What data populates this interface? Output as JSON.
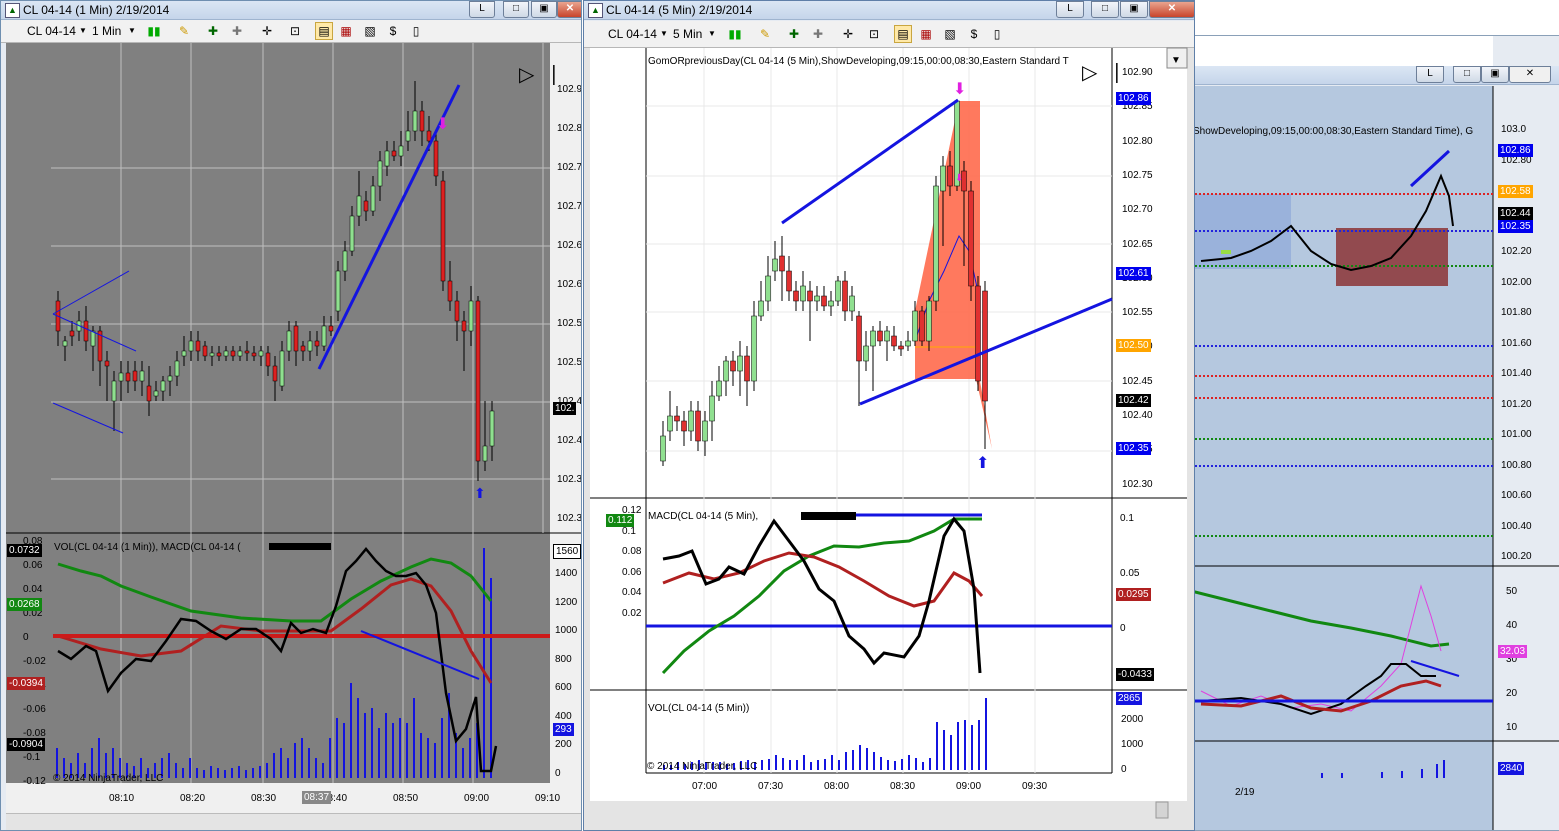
{
  "left_window": {
    "title": "CL 04-14 (1 Min)  2/19/2014",
    "instrument": "CL 04-14",
    "interval": "1 Min",
    "price_ticks": [
      "102.9",
      "102.8",
      "102.7",
      "102.7",
      "102.6",
      "102.6",
      "102.5",
      "102.5",
      "102.4",
      "102.4",
      "102.3",
      "102.3"
    ],
    "price_flag": "102.",
    "macd_title": "VOL(CL 04-14 (1 Min)), MACD(CL 04-14 (",
    "macd_ticks": [
      "0.08",
      "0.06",
      "0.04",
      "0.02",
      "0",
      "-0.02",
      "-0.04",
      "-0.06",
      "-0.08",
      "-0.1",
      "-0.12"
    ],
    "macd_flags": [
      "0.0732",
      "0.0268",
      "-0.0394",
      "-0.0904"
    ],
    "vol_ticks": [
      "1400",
      "1200",
      "1000",
      "800",
      "600",
      "400",
      "200",
      "0"
    ],
    "vol_flags": [
      "1560",
      "293"
    ],
    "copyright": "© 2014 NinjaTrader, LLC",
    "time_ticks": [
      "08:10",
      "08:20",
      "08:30",
      "08:40",
      "08:50",
      "09:00",
      "09:10"
    ],
    "cursor_time": "08:37"
  },
  "middle_window": {
    "title": "CL 04-14 (5 Min)  2/19/2014",
    "instrument": "CL 04-14",
    "interval": "5 Min",
    "indicator_title": "GomORpreviousDay(CL 04-14 (5 Min),ShowDeveloping,09:15,00:00,08:30,Eastern Standard T",
    "price_ticks": [
      "102.90",
      "102.85",
      "102.80",
      "102.75",
      "102.70",
      "102.65",
      "102.60",
      "102.55",
      "102.50",
      "102.45",
      "102.40",
      "102.35",
      "102.30"
    ],
    "price_flags": [
      {
        "text": "102.86",
        "color": "#0000ee"
      },
      {
        "text": "102.61",
        "color": "#0000ee"
      },
      {
        "text": "102.50",
        "color": "#ffa500"
      },
      {
        "text": "102.42",
        "color": "#000000"
      },
      {
        "text": "102.35",
        "color": "#0000ee"
      }
    ],
    "macd_title": "MACD(CL 04-14 (5 Min),",
    "macd_left_ticks": [
      "0.12",
      "0.1",
      "0.08",
      "0.06",
      "0.04",
      "0.02"
    ],
    "macd_left_flag": "0.112",
    "macd_right_ticks": [
      "0.1",
      "0.05",
      "0"
    ],
    "macd_right_flags": [
      "0.0295",
      "-0.0433"
    ],
    "vol_title": "VOL(CL 04-14 (5 Min))",
    "vol_ticks": [
      "2000",
      "1000",
      "0"
    ],
    "vol_flag": "2865",
    "copyright": "© 2014 NinjaTrader, LLC",
    "time_ticks": [
      "07:00",
      "07:30",
      "08:00",
      "08:30",
      "09:00",
      "09:30"
    ]
  },
  "right_window": {
    "indicator_title": "ShowDeveloping,09:15,00:00,08:30,Eastern Standard Time), G",
    "price_ticks": [
      "103.0",
      "102.80",
      "102.60",
      "102.40",
      "102.20",
      "102.00",
      "101.80",
      "101.60",
      "101.40",
      "101.20",
      "101.00",
      "100.80",
      "100.60",
      "100.40",
      "100.20"
    ],
    "price_flags": [
      {
        "text": "102.86",
        "color": "#0000ee"
      },
      {
        "text": "102.58",
        "color": "#ffa500"
      },
      {
        "text": "102.44",
        "color": "#000000"
      },
      {
        "text": "102.35",
        "color": "#0000ee"
      }
    ],
    "osc_ticks": [
      "50",
      "40",
      "30",
      "20",
      "10"
    ],
    "osc_flag": "32.03",
    "vol_flag": "2840",
    "date_label": "2/19"
  },
  "colors": {
    "blue_line": "#1414e0",
    "red_bar": "#e03030",
    "green_bar": "#90e090",
    "macd_green": "#118811",
    "macd_red": "#b02020"
  }
}
